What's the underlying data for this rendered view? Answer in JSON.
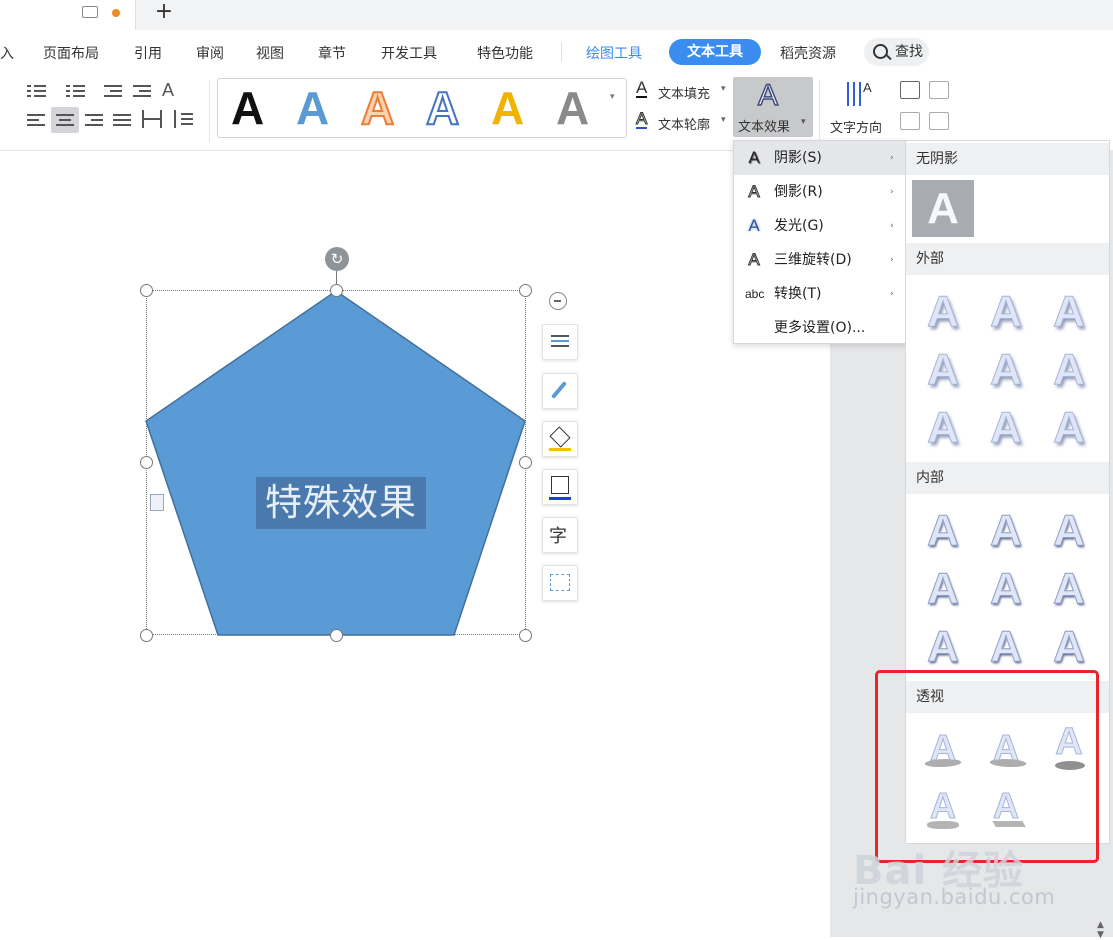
{
  "tabs": {
    "new_tab_label": "+"
  },
  "menubar": {
    "items": [
      "入",
      "页面布局",
      "引用",
      "审阅",
      "视图",
      "章节",
      "开发工具",
      "特色功能",
      "绘图工具",
      "文本工具",
      "稻壳资源"
    ],
    "search_label": "查找",
    "active_tab": "文本工具",
    "accent_color": "#3b8cf0"
  },
  "ribbon": {
    "gallery_letters": [
      "A",
      "A",
      "A",
      "A",
      "A",
      "A"
    ],
    "text_fill_label": "文本填充",
    "text_outline_label": "文本轮廓",
    "text_effect_label": "文本效果",
    "text_direction_label": "文字方向"
  },
  "effect_menu": {
    "items": [
      {
        "icon": "A",
        "label": "阴影(S)"
      },
      {
        "icon": "A",
        "label": "倒影(R)"
      },
      {
        "icon": "A",
        "label": "发光(G)"
      },
      {
        "icon": "A",
        "label": "三维旋转(D)"
      },
      {
        "icon": "abc",
        "label": "转换(T)"
      }
    ],
    "more_settings_label": "更多设置(O)...",
    "submenu_arrow": "›"
  },
  "shadow_panel": {
    "no_shadow_label": "无阴影",
    "outer_label": "外部",
    "inner_label": "内部",
    "perspective_label": "透视",
    "sample_letter": "A"
  },
  "shape": {
    "text": "特殊效果",
    "fill_color": "#5b9bd5",
    "stroke_color": "#41719c"
  },
  "side_toolbar": {
    "text_wrap_label": "字"
  },
  "watermark": {
    "brand": "Bai 经验",
    "url": "jingyan.baidu.com"
  }
}
